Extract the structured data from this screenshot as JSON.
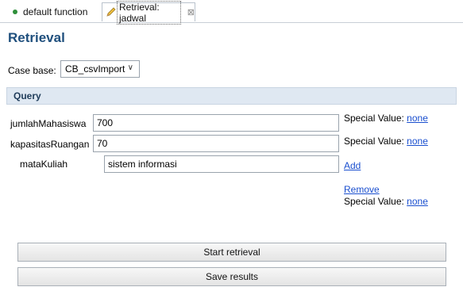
{
  "tabs": [
    {
      "label": "default function"
    },
    {
      "label": "Retrieval: jadwal",
      "close": "⊠"
    }
  ],
  "page_title": "Retrieval",
  "case_base": {
    "label": "Case base:",
    "value": "CB_csvImport"
  },
  "query": {
    "title": "Query",
    "fields": [
      {
        "name": "jumlahMahasiswa",
        "value": "700",
        "special_label": "Special Value:",
        "special_link": "none"
      },
      {
        "name": "kapasitasRuangan",
        "value": "70",
        "special_label": "Special Value:",
        "special_link": "none"
      },
      {
        "name": "mataKuliah",
        "value": "sistem informasi",
        "add_link": "Add",
        "remove_link": "Remove",
        "special_label": "Special Value:",
        "special_link": "none"
      }
    ]
  },
  "buttons": {
    "start": "Start retrieval",
    "save": "Save results"
  },
  "colors": {
    "title": "#1f4f7d",
    "query_bar": "#dfe8f2",
    "link": "#1a4fcf"
  }
}
